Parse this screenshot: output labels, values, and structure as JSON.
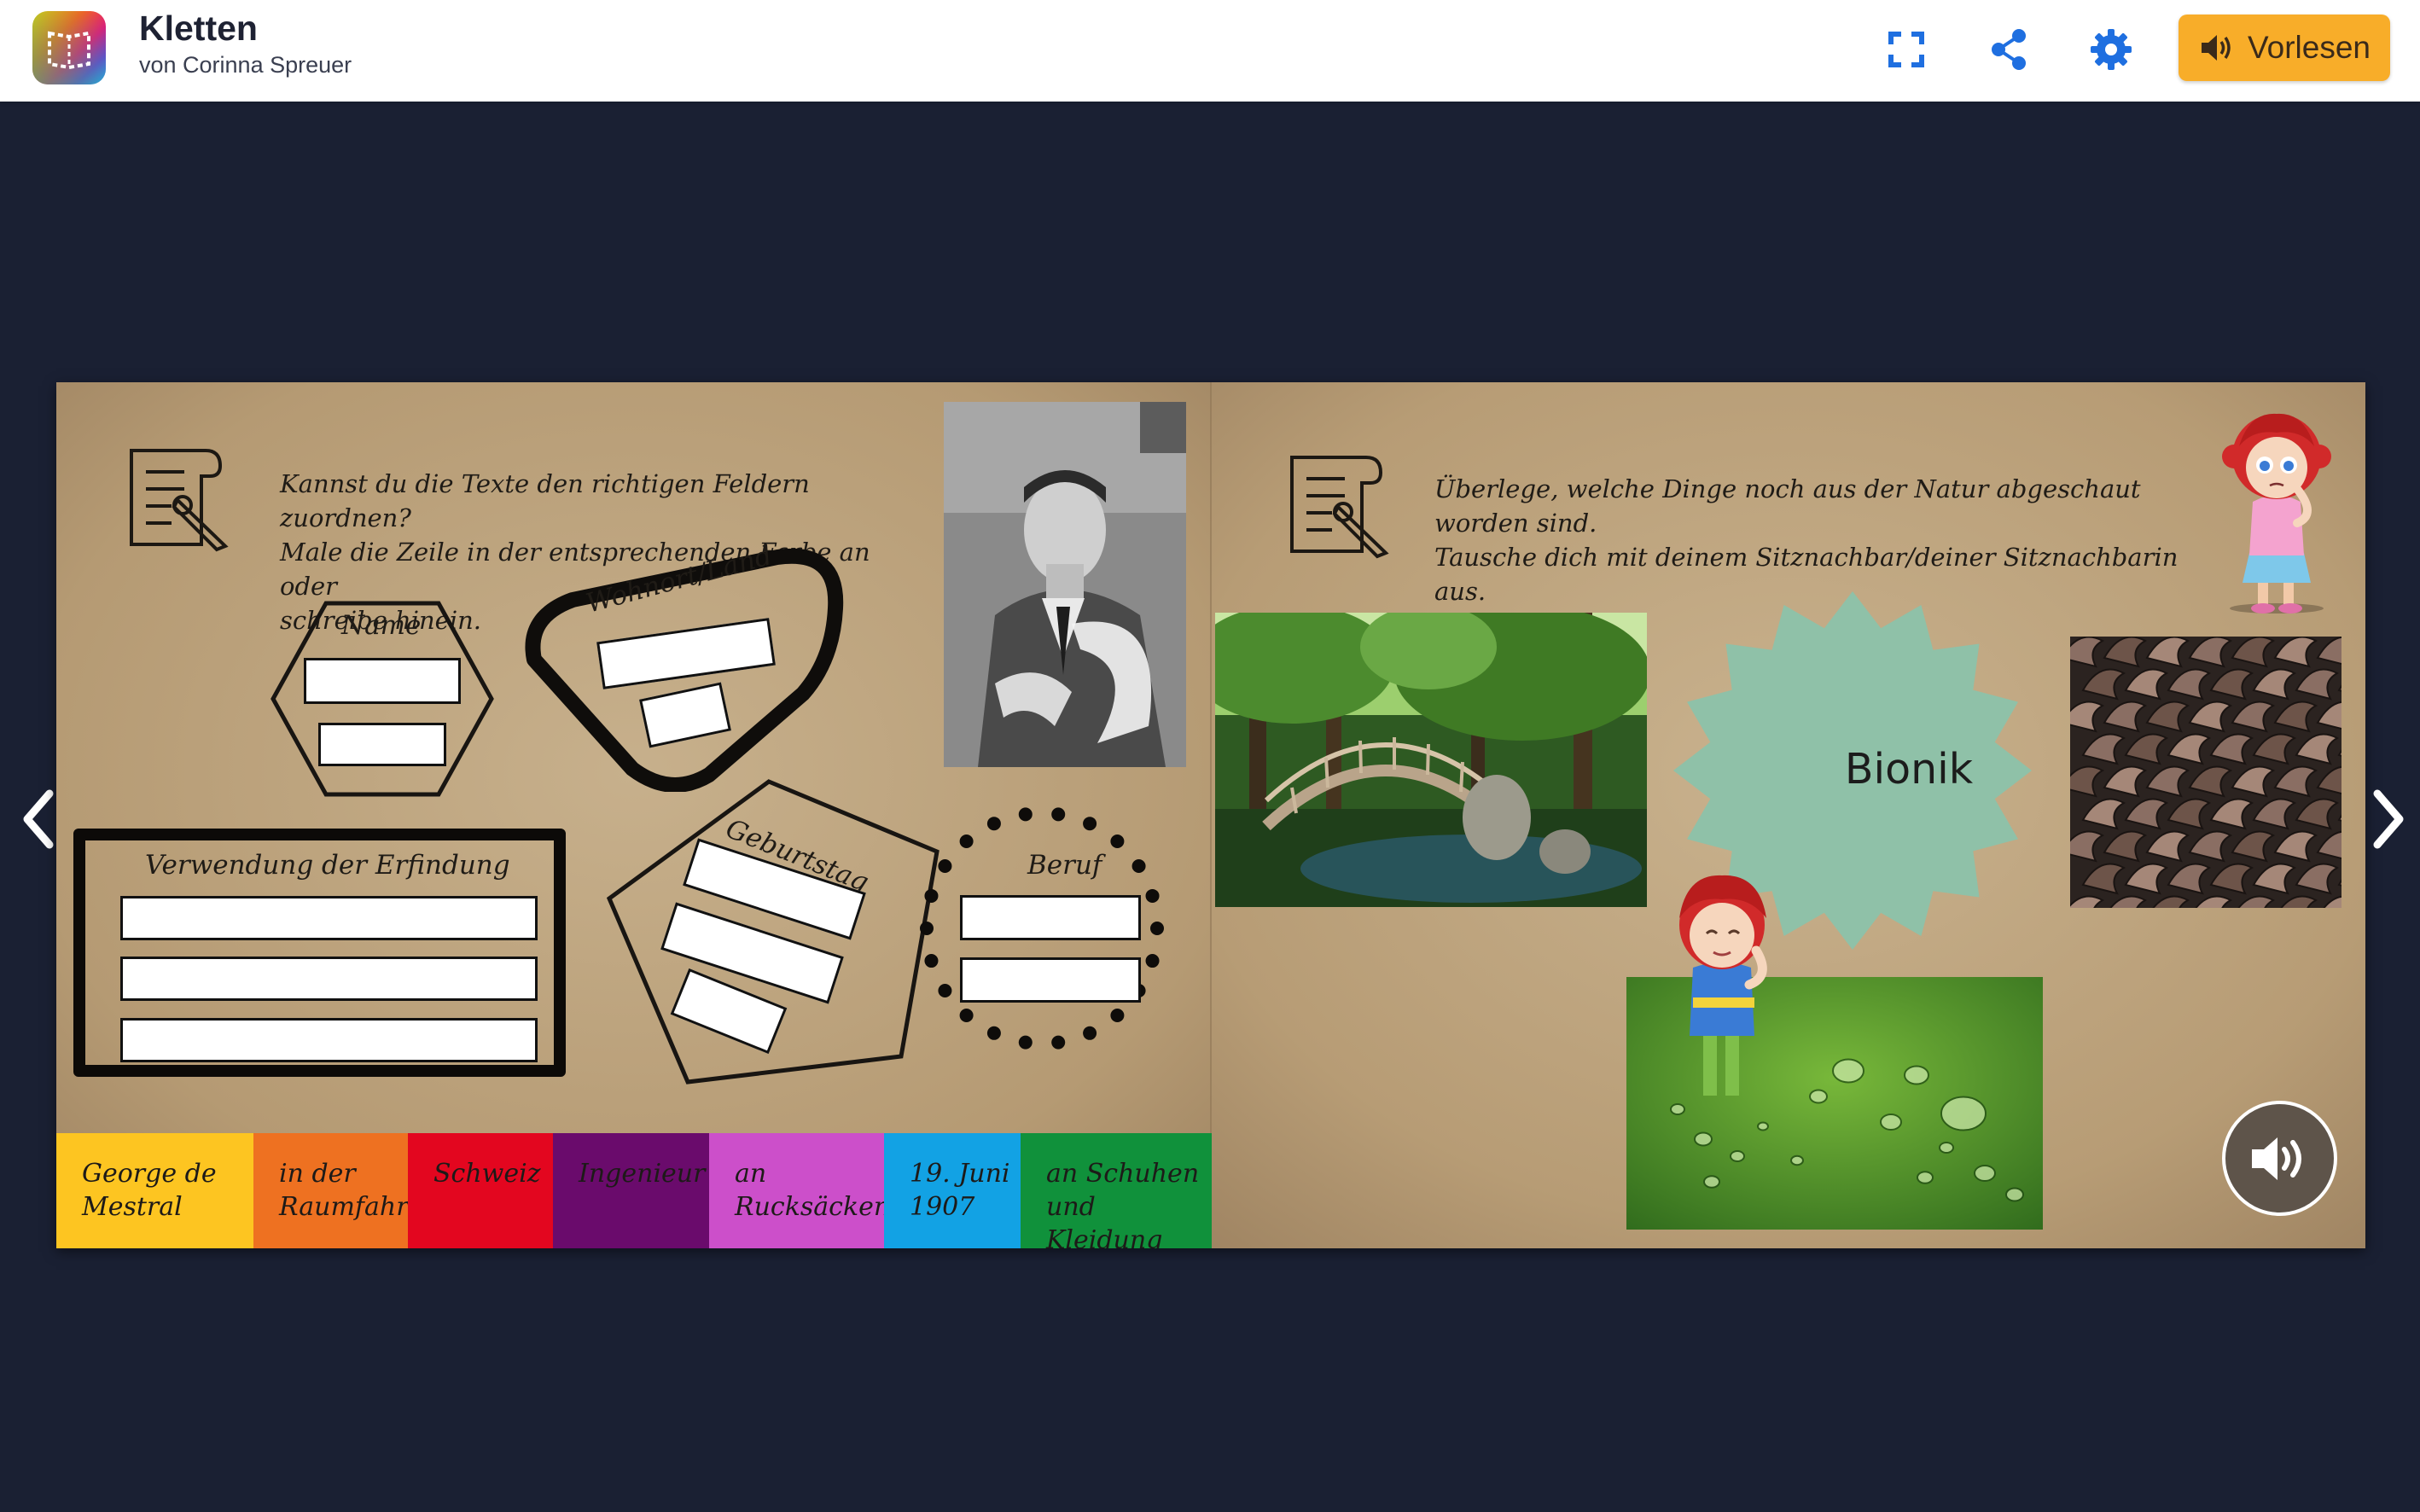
{
  "header": {
    "title": "Kletten",
    "author": "von Corinna Spreuer",
    "read_aloud_label": "Vorlesen",
    "fullscreen_icon": "fullscreen-icon",
    "share_icon": "share-icon",
    "settings_icon": "gear-icon",
    "accent_color": "#f8ad29",
    "icon_color": "#1f6fe0"
  },
  "left_page": {
    "task_text": "Kannst du die Texte den richtigen Feldern zuordnen?\nMale die Zeile in der entsprechenden Farbe an oder\nschreibe hinein.",
    "fields": {
      "name": "Name",
      "wohnort": "Wohnort/Land",
      "verwendung": "Verwendung der Erfindung",
      "geburtstag": "Geburtstag",
      "beruf": "Beruf"
    }
  },
  "color_chips": [
    {
      "text": "George de\nMestral",
      "color": "#fdc521"
    },
    {
      "text": "in der\nRaumfahrt",
      "color": "#ee7121"
    },
    {
      "text": "Schweiz",
      "color": "#e3061f"
    },
    {
      "text": "Ingenieur",
      "color": "#6a0b6c"
    },
    {
      "text": "an\nRucksäcken",
      "color": "#cc4fca"
    },
    {
      "text": "19. Juni\n1907",
      "color": "#12a2e4"
    },
    {
      "text": "an Schuhen\nund Kleidung",
      "color": "#10913b"
    }
  ],
  "right_page": {
    "task_text": "Überlege, welche Dinge noch aus der Natur abgeschaut worden sind.\nTausche dich mit deinem Sitznachbar/deiner Sitznachbarin aus.",
    "center_label": "Bionik",
    "center_color": "#8fc1a8"
  }
}
